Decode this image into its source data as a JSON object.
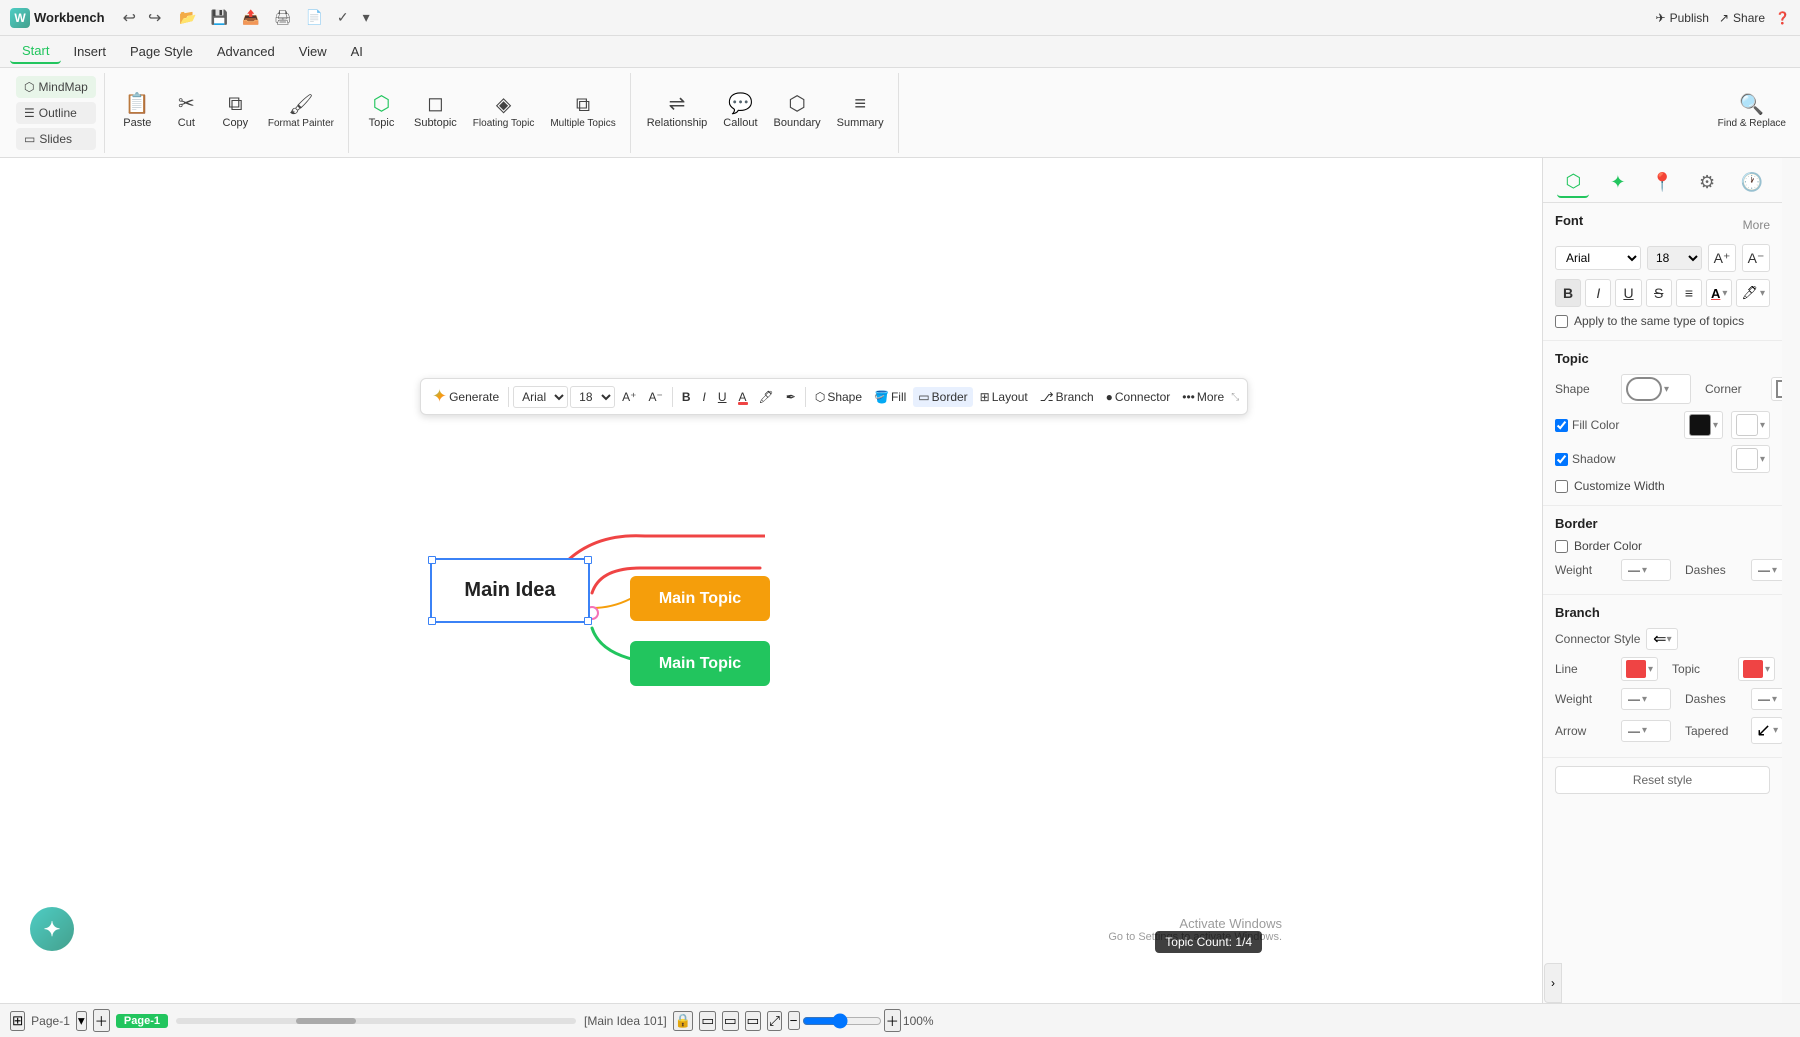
{
  "titlebar": {
    "app_name": "Workbench",
    "publish_label": "Publish",
    "share_label": "Share"
  },
  "menubar": {
    "items": [
      "Start",
      "Insert",
      "Page Style",
      "Advanced",
      "View",
      "AI"
    ]
  },
  "toolbar": {
    "paste_label": "Paste",
    "cut_label": "Cut",
    "copy_label": "Copy",
    "format_painter_label": "Format Painter",
    "topic_label": "Topic",
    "subtopic_label": "Subtopic",
    "floating_topic_label": "Floating Topic",
    "multiple_topics_label": "Multiple Topics",
    "relationship_label": "Relationship",
    "callout_label": "Callout",
    "boundary_label": "Boundary",
    "summary_label": "Summary",
    "find_replace_label": "Find & Replace",
    "mindmap_label": "MindMap",
    "outline_label": "Outline",
    "slides_label": "Slides"
  },
  "floating_toolbar": {
    "font_family": "Arial",
    "font_size": "18",
    "generate_label": "Generate",
    "shape_label": "Shape",
    "fill_label": "Fill",
    "border_label": "Border",
    "layout_label": "Layout",
    "branch_label": "Branch",
    "connector_label": "Connector",
    "more_label": "More"
  },
  "canvas": {
    "main_idea_label": "Main Idea",
    "main_topic_orange_label": "Main Topic",
    "main_topic_green_label": "Main Topic"
  },
  "right_panel": {
    "font_section_title": "Font",
    "more_label": "More",
    "font_family": "Arial",
    "font_size": "18",
    "apply_same_label": "Apply to the same type of topics",
    "topic_section_title": "Topic",
    "shape_label": "Shape",
    "corner_label": "Corner",
    "fill_color_label": "Fill Color",
    "shadow_label": "Shadow",
    "customize_width_label": "Customize Width",
    "border_section_title": "Border",
    "border_color_label": "Border Color",
    "weight_label": "Weight",
    "dashes_label": "Dashes",
    "branch_section_title": "Branch",
    "connector_style_label": "Connector Style",
    "line_label": "Line",
    "topic_label": "Topic",
    "arrow_label": "Arrow",
    "tapered_label": "Tapered",
    "reset_style_label": "Reset style"
  },
  "status_bar": {
    "page_label": "Page-1",
    "page_tab_label": "Page-1",
    "info_label": "[Main Idea 101]",
    "topic_count_label": "Topic Count: 1/4",
    "zoom_label": "100%"
  }
}
